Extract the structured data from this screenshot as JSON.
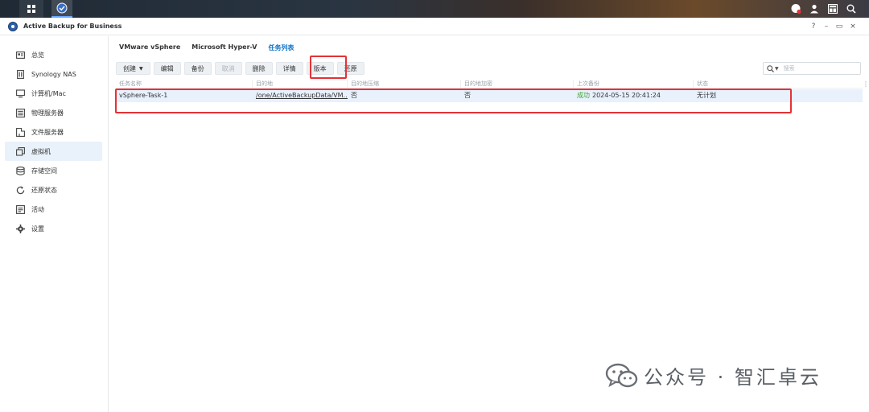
{
  "window": {
    "title": "Active Backup for Business",
    "help": "?",
    "minimize": "–",
    "restore": "▭",
    "close": "×"
  },
  "sidebar": {
    "items": [
      {
        "label": "总览",
        "icon": "overview-icon"
      },
      {
        "label": "Synology NAS",
        "icon": "nas-icon"
      },
      {
        "label": "计算机/Mac",
        "icon": "computer-icon"
      },
      {
        "label": "物理服务器",
        "icon": "server-icon"
      },
      {
        "label": "文件服务器",
        "icon": "file-server-icon"
      },
      {
        "label": "虚拟机",
        "icon": "vm-icon",
        "active": true
      },
      {
        "label": "存储空间",
        "icon": "storage-icon"
      },
      {
        "label": "还原状态",
        "icon": "restore-status-icon"
      },
      {
        "label": "活动",
        "icon": "activity-icon"
      },
      {
        "label": "设置",
        "icon": "gear-icon"
      }
    ]
  },
  "tabs": [
    {
      "label": "VMware vSphere"
    },
    {
      "label": "Microsoft Hyper-V"
    },
    {
      "label": "任务列表",
      "active": true
    }
  ],
  "toolbar": {
    "create": "创建",
    "edit": "编辑",
    "backup": "备份",
    "cancel": "取消",
    "delete": "删除",
    "details": "详情",
    "version": "版本",
    "restore": "还原"
  },
  "search": {
    "placeholder": "搜索"
  },
  "table": {
    "headers": [
      "任务名称",
      "目的地",
      "目的地压缩",
      "目的地加密",
      "上次备份",
      "状态"
    ],
    "rows": [
      {
        "name": "vSphere-Task-1",
        "destination": "/one/ActiveBackupData/VM...",
        "compression": "否",
        "encryption": "否",
        "last_status": "成功",
        "last_time": "2024-05-15 20:41:24",
        "status": "无计划"
      }
    ]
  },
  "watermark": "公众号 · 智汇卓云",
  "colors": {
    "accent": "#0a71c8",
    "success": "#3ca32f",
    "highlight": "#e43236",
    "selected_row": "#e8f1fc"
  }
}
